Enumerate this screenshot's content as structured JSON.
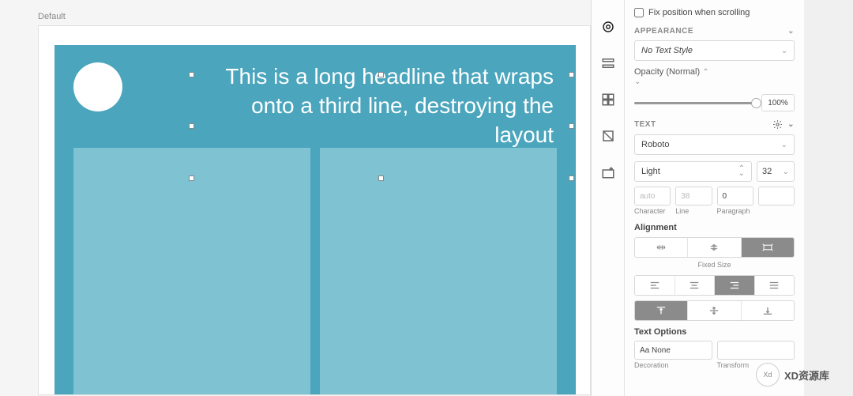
{
  "canvas": {
    "artboard_label": "Default",
    "headline_text": "This is a long headline that wraps onto a third line, destroying the layout",
    "colors": {
      "card_bg": "#4aa5bd",
      "col_bg": "#7fc2d2"
    }
  },
  "inspector": {
    "fix_position_label": "Fix position when scrolling",
    "appearance": {
      "title": "APPEARANCE",
      "text_style": "No Text Style",
      "opacity_label": "Opacity (Normal)",
      "opacity_value": "100%"
    },
    "text": {
      "title": "TEXT",
      "font_family": "Roboto",
      "font_weight": "Light",
      "font_size": "32",
      "spacing": {
        "character": {
          "value": "",
          "placeholder": "auto",
          "label": "Character"
        },
        "line": {
          "value": "",
          "placeholder": "38",
          "label": "Line"
        },
        "paragraph": {
          "value": "0",
          "placeholder": "",
          "label": "Paragraph"
        }
      },
      "alignment_label": "Alignment",
      "fixed_size_label": "Fixed Size",
      "options_title": "Text Options",
      "decoration_value": "Aa None",
      "decoration_label": "Decoration",
      "transform_label": "Transform"
    }
  },
  "watermark": {
    "text": "XD资源库"
  }
}
